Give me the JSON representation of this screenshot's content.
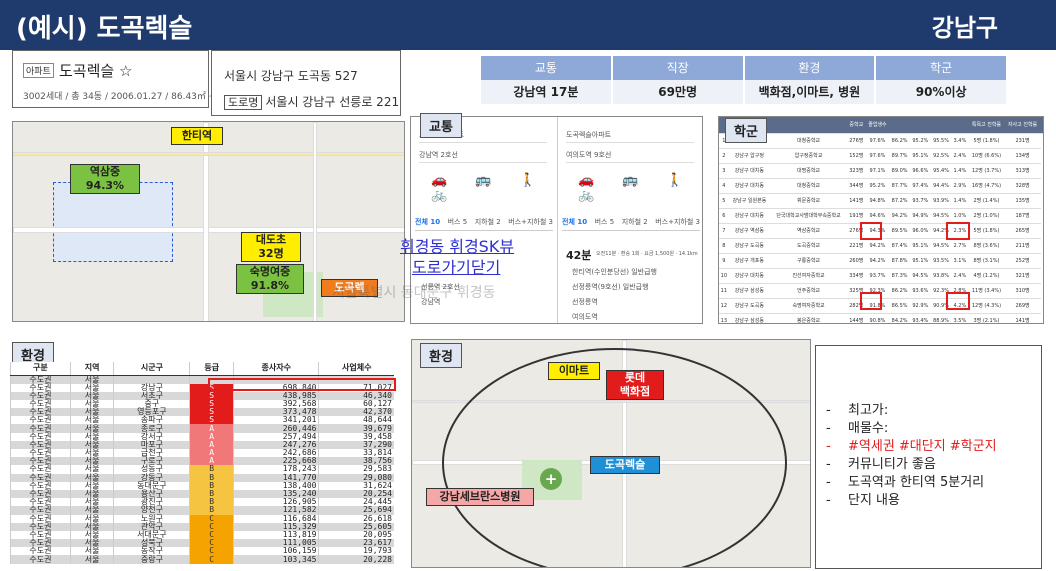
{
  "header": {
    "title": "(예시) 도곡렉슬",
    "region": "강남구"
  },
  "apt": {
    "tag": "아파트",
    "name": "도곡렉슬 ☆",
    "sub": "3002세대 / 총 34동 / 2006.01.27 / 86.43㎡ ~ 225.29㎡"
  },
  "address": {
    "line1": "서울시 강남구 도곡동 527",
    "road_tag": "도로명",
    "line2": "서울시 강남구 선릉로 221"
  },
  "stats": {
    "headers": [
      "교통",
      "직장",
      "환경",
      "학군"
    ],
    "values": [
      "강남역 17분",
      "69만명",
      "백화점,이마트, 병원",
      "90%이상"
    ]
  },
  "map1": {
    "station_label": "한티역",
    "school1_name": "역삼중",
    "school1_rate": "94.3%",
    "school2_name": "대도초",
    "school2_count": "32명",
    "school3_name": "숙명여중",
    "school3_rate": "91.8%",
    "apt_label": "도곡렉"
  },
  "transit": {
    "title": "교통",
    "from_left": "도곡렉슬아파트",
    "to_left": "강남역 2호선",
    "from_right": "도곡렉슬아파트",
    "to_right": "여의도역 9호선",
    "modes": "🚗 🚌 🚶 🚲",
    "tabs_left": [
      "전체 10",
      "버스 5",
      "지하철 2",
      "버스+지하철 3"
    ],
    "tabs_right": [
      "전체 10",
      "버스 5",
      "지하철 2",
      "버스+지하철 3"
    ],
    "route_time": "42분",
    "route_detail": "오전11분 · 환승 1회 · 요금 1,500원 · 14.1km",
    "steps": [
      "한티역(수인분당선) 일반급행",
      "선정릉역(9호선) 일반급행",
      "선정릉역",
      "여의도역"
    ],
    "left_steps": [
      "선릉역 2호선",
      "강남역"
    ],
    "overlay_line1": "휘경동 휘경SK뷰",
    "overlay_line2": "도로가기닫기",
    "overlay_line3": "서울특별시 동대문구 휘경동"
  },
  "school": {
    "title": "학군",
    "headers": [
      "",
      "학교명",
      "",
      "중학교",
      "졸업생수",
      "",
      "",
      "",
      "",
      "특목고 진학률",
      "자사고 진학률",
      ""
    ],
    "rows": [
      [
        "1",
        "강남구 도곡동",
        "대청중학교",
        "276명",
        "97.6%",
        "86.2%",
        "95.2%",
        "95.5%",
        "3.4%",
        "5명 (1.8%)",
        "231명"
      ],
      [
        "2",
        "강남구 압구정",
        "압구정중학교",
        "152명",
        "97.6%",
        "89.7%",
        "95.1%",
        "92.5%",
        "2.4%",
        "10명 (6.6%)",
        "134명"
      ],
      [
        "3",
        "강남구 대치동",
        "대명중학교",
        "323명",
        "97.1%",
        "89.0%",
        "96.6%",
        "95.4%",
        "1.4%",
        "12명 (3.7%)",
        "313명"
      ],
      [
        "4",
        "강남구 대치동",
        "대청중학교",
        "344명",
        "95.2%",
        "87.7%",
        "97.4%",
        "94.4%",
        "2.9%",
        "16명 (4.7%)",
        "328명"
      ],
      [
        "5",
        "강남구 일원본동",
        "휘문중학교",
        "141명",
        "94.8%",
        "87.2%",
        "93.7%",
        "93.9%",
        "1.4%",
        "2명 (1.4%)",
        "135명"
      ],
      [
        "6",
        "강남구 대치동",
        "단국대학교사범대학부속중학교",
        "191명",
        "94.6%",
        "94.2%",
        "94.9%",
        "94.5%",
        "1.0%",
        "2명 (1.0%)",
        "187명"
      ],
      [
        "7",
        "강남구 역삼동",
        "역삼중학교",
        "276명",
        "94.3%",
        "89.5%",
        "96.0%",
        "94.2%",
        "2.3%",
        "5명 (1.8%)",
        "265명"
      ],
      [
        "8",
        "강남구 도곡동",
        "도곡중학교",
        "221명",
        "94.2%",
        "87.4%",
        "95.1%",
        "94.5%",
        "2.7%",
        "8명 (3.6%)",
        "211명"
      ],
      [
        "9",
        "강남구 개포동",
        "구룡중학교",
        "260명",
        "94.2%",
        "87.8%",
        "95.1%",
        "93.5%",
        "3.1%",
        "8명 (3.1%)",
        "252명"
      ],
      [
        "10",
        "강남구 대치동",
        "진선여자중학교",
        "334명",
        "93.7%",
        "87.3%",
        "94.5%",
        "93.8%",
        "2.4%",
        "4명 (1.2%)",
        "321명"
      ],
      [
        "11",
        "강남구 삼성동",
        "언주중학교",
        "325명",
        "92.3%",
        "86.2%",
        "93.6%",
        "92.3%",
        "2.8%",
        "11명 (3.4%)",
        "310명"
      ],
      [
        "12",
        "강남구 도곡동",
        "숙명여자중학교",
        "282명",
        "91.8%",
        "86.5%",
        "92.9%",
        "90.9%",
        "4.2%",
        "12명 (4.3%)",
        "269명"
      ],
      [
        "13",
        "강남구 삼성동",
        "봉은중학교",
        "144명",
        "90.8%",
        "84.2%",
        "93.4%",
        "88.9%",
        "3.5%",
        "3명 (2.1%)",
        "141명"
      ]
    ]
  },
  "envt": {
    "title": "환경",
    "headers": [
      "구분",
      "지역",
      "시군구",
      "등급",
      "종사자수",
      "사업체수"
    ],
    "rows": [
      [
        "수도권",
        "서울",
        "",
        "",
        "",
        ""
      ],
      [
        "수도권",
        "서울",
        "강남구",
        "S",
        "698,840",
        "71,027"
      ],
      [
        "수도권",
        "서울",
        "서초구",
        "S",
        "438,985",
        "46,340"
      ],
      [
        "수도권",
        "서울",
        "중구",
        "S",
        "392,568",
        "60,127"
      ],
      [
        "수도권",
        "서울",
        "영등포구",
        "S",
        "373,478",
        "42,370"
      ],
      [
        "수도권",
        "서울",
        "송파구",
        "S",
        "341,201",
        "48,644"
      ],
      [
        "수도권",
        "서울",
        "종로구",
        "A",
        "260,446",
        "39,679"
      ],
      [
        "수도권",
        "서울",
        "강서구",
        "A",
        "257,494",
        "39,458"
      ],
      [
        "수도권",
        "서울",
        "마포구",
        "A",
        "247,276",
        "37,290"
      ],
      [
        "수도권",
        "서울",
        "금천구",
        "A",
        "242,686",
        "33,814"
      ],
      [
        "수도권",
        "서울",
        "구로구",
        "A",
        "225,668",
        "38,756"
      ],
      [
        "수도권",
        "서울",
        "성동구",
        "B",
        "178,243",
        "29,583"
      ],
      [
        "수도권",
        "서울",
        "강동구",
        "B",
        "141,770",
        "29,080"
      ],
      [
        "수도권",
        "서울",
        "동대문구",
        "B",
        "138,400",
        "31,624"
      ],
      [
        "수도권",
        "서울",
        "용산구",
        "B",
        "135,240",
        "20,254"
      ],
      [
        "수도권",
        "서울",
        "광진구",
        "B",
        "126,905",
        "24,445"
      ],
      [
        "수도권",
        "서울",
        "양천구",
        "B",
        "121,582",
        "25,694"
      ],
      [
        "수도권",
        "서울",
        "노원구",
        "C",
        "116,684",
        "26,618"
      ],
      [
        "수도권",
        "서울",
        "관악구",
        "C",
        "115,329",
        "25,605"
      ],
      [
        "수도권",
        "서울",
        "서대문구",
        "C",
        "113,819",
        "20,095"
      ],
      [
        "수도권",
        "서울",
        "성북구",
        "C",
        "111,005",
        "23,617"
      ],
      [
        "수도권",
        "서울",
        "동작구",
        "C",
        "106,159",
        "19,793"
      ],
      [
        "수도권",
        "서울",
        "중랑구",
        "C",
        "103,345",
        "20,228"
      ]
    ]
  },
  "map2": {
    "title": "환경",
    "emart": "이마트",
    "lotte": "롯데\n백화점",
    "apt": "도곡렉슬",
    "hospital": "강남세브란스병원"
  },
  "notes": {
    "items": [
      {
        "text": "최고가:",
        "highlight": false
      },
      {
        "text": "매물수:",
        "highlight": false
      },
      {
        "text": "#역세권 #대단지 #학군지",
        "highlight": true
      },
      {
        "text": "커뮤니티가 좋음",
        "highlight": false
      },
      {
        "text": "도곡역과 한티역 5분거리",
        "highlight": false
      },
      {
        "text": "단지 내용",
        "highlight": false
      }
    ]
  }
}
